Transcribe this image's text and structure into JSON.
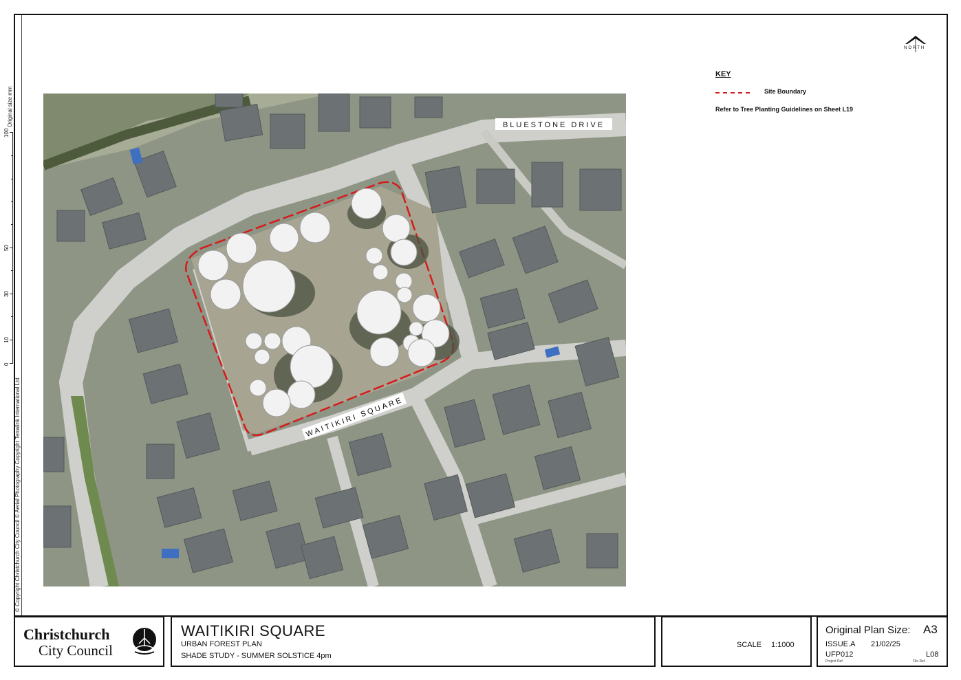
{
  "sheet": {
    "ruler_caption": "Original size mm",
    "ruler_ticks": [
      "100",
      "50",
      "30",
      "10",
      "0"
    ],
    "copyright": "© Copyright Christchurch City Council   © Aerial Photography Copyright Terralink International Ltd"
  },
  "map": {
    "road_labels": [
      "BLUESTONE DRIVE",
      "WAITIKIRI SQUARE"
    ],
    "north_label": "NORTH"
  },
  "key": {
    "title": "KEY",
    "items": [
      {
        "label": "Site Boundary",
        "color": "#d71a1a",
        "style": "dashed"
      }
    ],
    "note": "Refer to Tree Planting Guidelines on Sheet L19"
  },
  "title_block": {
    "logo_line1": "Christchurch",
    "logo_line2": "City Council",
    "project_title": "WAITIKIRI SQUARE",
    "subtitle1": "URBAN FOREST PLAN",
    "subtitle2": "SHADE STUDY - SUMMER SOLSTICE 4pm",
    "scale_label": "SCALE",
    "scale_value": "1:1000",
    "plan_size_label": "Original Plan Size:",
    "plan_size_value": "A3",
    "issue": "ISSUE.A",
    "date": "21/02/25",
    "project_ref": "UFP012",
    "file_ref": "L08",
    "project_ref_caption": "Project Ref.",
    "file_ref_caption": "File Ref."
  }
}
